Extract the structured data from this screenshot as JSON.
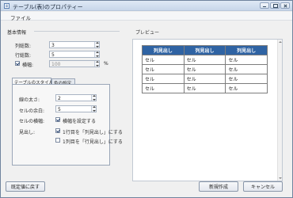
{
  "window": {
    "title": "テーブル(表)のプロパティー",
    "icon": "table-icon"
  },
  "menu": {
    "file": "ファイル"
  },
  "basic": {
    "heading": "基本情報",
    "columns_label": "列総数:",
    "columns_value": "3",
    "rows_label": "行総数:",
    "rows_value": "5",
    "width_label": "横幅:",
    "width_checked": true,
    "width_value": "100",
    "width_unit": "%"
  },
  "style_tabs": {
    "tab_style": "テーブルのスタイル",
    "tab_color": "色の設定"
  },
  "style": {
    "line_thickness_label": "線の太さ:",
    "line_thickness_value": "2",
    "cell_padding_label": "セルの余白:",
    "cell_padding_value": "5",
    "cell_spacing_label": "セルの横幅:",
    "cell_spacing_check_label": "横幅を設定する",
    "cell_spacing_checked": true,
    "header_label": "見出し:",
    "header_row_label": "1行目を「列見出し」にする",
    "header_row_checked": true,
    "header_col_label": "1列目を「行見出し」にする",
    "header_col_checked": false
  },
  "preview": {
    "heading": "プレビュー",
    "headers": [
      "列見出し",
      "列見出し",
      "列見出し"
    ],
    "rows": [
      [
        "セル",
        "セル",
        "セル"
      ],
      [
        "セル",
        "セル",
        "セル"
      ],
      [
        "セル",
        "セル",
        "セル"
      ],
      [
        "セル",
        "セル",
        "セル"
      ]
    ],
    "header_color": "#2f63a3"
  },
  "buttons": {
    "reset": "既定値に戻す",
    "create": "新規作成",
    "cancel": "キャンセル"
  }
}
